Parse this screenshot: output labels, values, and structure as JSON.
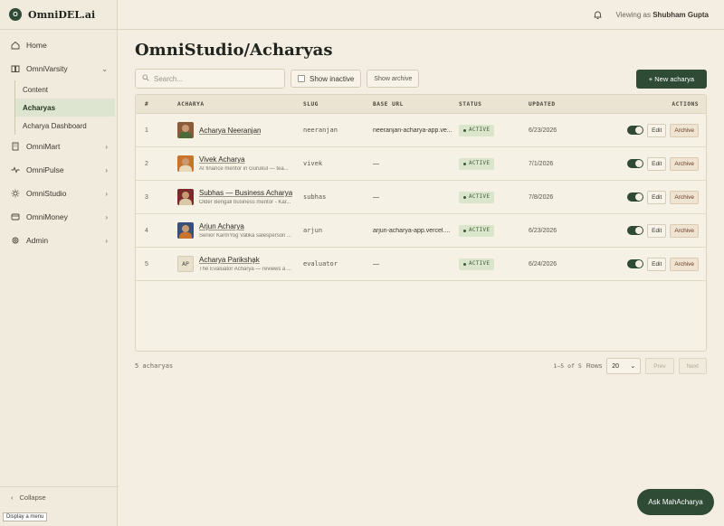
{
  "brand": {
    "logo_letter": "O",
    "name": "OmniDEL.ai"
  },
  "sidebar": {
    "items": [
      {
        "label": "Home",
        "icon": "home-icon"
      },
      {
        "label": "OmniVarsity",
        "icon": "book-icon",
        "expanded": true,
        "children": [
          {
            "label": "Content"
          },
          {
            "label": "Acharyas",
            "active": true
          },
          {
            "label": "Acharya Dashboard"
          }
        ]
      },
      {
        "label": "OmniMart",
        "icon": "building-icon"
      },
      {
        "label": "OmniPulse",
        "icon": "pulse-icon"
      },
      {
        "label": "OmniStudio",
        "icon": "sun-icon"
      },
      {
        "label": "OmniMoney",
        "icon": "wallet-icon"
      },
      {
        "label": "Admin",
        "icon": "gear-icon"
      }
    ],
    "collapse_label": "Collapse"
  },
  "topbar": {
    "viewing_prefix": "Viewing as",
    "user": "Shubham Gupta"
  },
  "page": {
    "title": "OmniStudio/Acharyas"
  },
  "toolbar": {
    "search_placeholder": "Search...",
    "show_inactive": "Show inactive",
    "show_archive": "Show archive",
    "new_button": "+ New acharya"
  },
  "table": {
    "headers": {
      "num": "#",
      "acharya": "ACHARYA",
      "slug": "SLUG",
      "base_url": "BASE URL",
      "status": "STATUS",
      "updated": "UPDATED",
      "actions": "ACTIONS"
    },
    "rows": [
      {
        "num": "1",
        "name": "Acharya Neeranjan",
        "desc": "",
        "slug": "neeranjan",
        "base_url": "neeranjan-acharya-app.ve...",
        "status": "ACTIVE",
        "updated": "6/23/2026",
        "avatar_color": "#8a5a3a",
        "edit": "Edit",
        "archive": "Archive",
        "enabled": true
      },
      {
        "num": "2",
        "name": "Vivek Acharya",
        "desc": "AI finance mentor in Gurukul — tea...",
        "slug": "vivek",
        "base_url": "—",
        "status": "ACTIVE",
        "updated": "7/1/2026",
        "avatar_color": "#c9742e",
        "edit": "Edit",
        "archive": "Archive",
        "enabled": true
      },
      {
        "num": "3",
        "name": "Subhas — Business Acharya",
        "desc": "Older Bengali business mentor - Kar...",
        "slug": "subhas",
        "base_url": "—",
        "status": "ACTIVE",
        "updated": "7/8/2026",
        "avatar_color": "#7a2a2a",
        "edit": "Edit",
        "archive": "Archive",
        "enabled": true
      },
      {
        "num": "4",
        "name": "Arjun Acharya",
        "desc": "Senior KarmYog Vatika salesperson ...",
        "slug": "arjun",
        "base_url": "arjun-acharya-app.vercel....",
        "status": "ACTIVE",
        "updated": "6/23/2026",
        "avatar_color": "#3a4f7a",
        "edit": "Edit",
        "archive": "Archive",
        "enabled": true
      },
      {
        "num": "5",
        "name": "Acharya Pariksha̧k",
        "desc": "The Evaluator Acharya — reviews a ...",
        "slug": "evaluator",
        "base_url": "—",
        "status": "ACTIVE",
        "updated": "6/24/2026",
        "initials": "AP",
        "edit": "Edit",
        "archive": "Archive",
        "enabled": true
      }
    ]
  },
  "footer": {
    "count": "5 acharyas",
    "range": "1–5 of 5",
    "rows_label": "Rows",
    "rows_value": "20",
    "prev": "Prev",
    "next": "Next"
  },
  "fab": {
    "label": "Ask MahAcharya"
  },
  "tooltip": {
    "label": "Display a menu"
  },
  "colors": {
    "accent": "#2f4a35",
    "background": "#f3eee1",
    "status_active_bg": "#dbe5cc"
  }
}
